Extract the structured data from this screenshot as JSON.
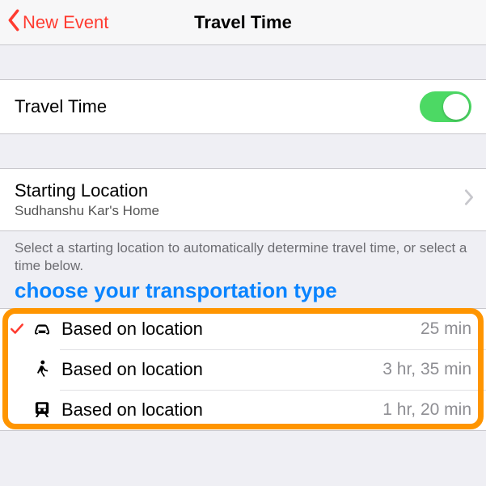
{
  "nav": {
    "back_label": "New Event",
    "title": "Travel Time"
  },
  "toggle_row": {
    "label": "Travel Time",
    "enabled": true
  },
  "starting_location": {
    "title": "Starting Location",
    "value": "Sudhanshu Kar's Home"
  },
  "footer_note": "Select a starting location to automatically determine travel time, or select a time below.",
  "annotation": "choose your transportation type",
  "transport_options": [
    {
      "icon": "car",
      "label": "Based on location",
      "duration": "25 min",
      "selected": true
    },
    {
      "icon": "walk",
      "label": "Based on location",
      "duration": "3 hr, 35 min",
      "selected": false
    },
    {
      "icon": "train",
      "label": "Based on location",
      "duration": "1 hr, 20 min",
      "selected": false
    }
  ]
}
